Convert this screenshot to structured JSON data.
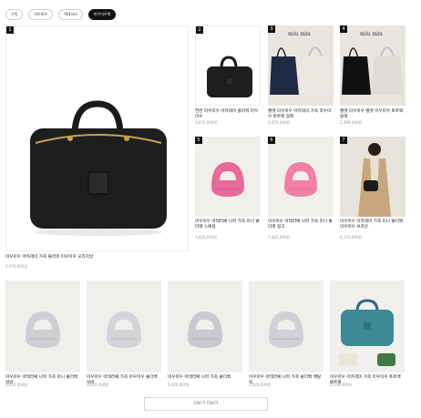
{
  "filters": [
    {
      "label": "구독",
      "active": false
    },
    {
      "label": "미우미우",
      "active": false
    },
    {
      "label": "액세서리",
      "active": false
    },
    {
      "label": "미우미우백",
      "active": true
    }
  ],
  "products": [
    {
      "rank": "1",
      "name": "미우미우 아카데미 가죽 플라워 미우미우 오리지날",
      "price": "4,970,000원",
      "brand_text": ""
    },
    {
      "rank": "2",
      "name": "한번 미우미우 아카데미 플라워 미우미우",
      "price": "4,970,000원",
      "brand_text": ""
    },
    {
      "rank": "3",
      "name": "벨벳 미우미우 아카데미 가죽 미우미우 토트백 블랙",
      "price": "2,970,000원",
      "brand_text": "miu miu"
    },
    {
      "rank": "4",
      "name": "벨벳 미우미우 벨벳 미우미우 토트백 블랙",
      "price": "2,390,000원",
      "brand_text": "miu miu"
    },
    {
      "rank": "5",
      "name": "미우미우 마테라쎄 나파 가죽 미니 숄더백 스페셜",
      "price": "3,420,000원",
      "brand_text": ""
    },
    {
      "rank": "6",
      "name": "미우미우 마테라쎄 나파 가죽 미니 숄더백 핑크",
      "price": "3,420,000원",
      "brand_text": ""
    },
    {
      "rank": "7",
      "name": "미우미우 아카데미 가죽 미니 숄더백 미우미우 브라운",
      "price": "6,150,000원",
      "brand_text": ""
    },
    {
      "rank": "",
      "name": "미우미우 마테라쎄 나파 가죽 미니 숄더백 실버",
      "price": "3,420,000원",
      "brand_text": ""
    },
    {
      "rank": "",
      "name": "미우미우 마테라쎄 가죽 미우미우 숄더백 실버",
      "price": "3,420,000원",
      "brand_text": ""
    },
    {
      "rank": "",
      "name": "미우미우 마테라쎄 나파 가죽 숄더백",
      "price": "3,420,000원",
      "brand_text": ""
    },
    {
      "rank": "",
      "name": "미우미우 마테라쎄 나파 가죽 숄더백 메탈릭",
      "price": "3,420,000원",
      "brand_text": ""
    },
    {
      "rank": "",
      "name": "미우미우 아카데미 가죽 미우미우 토트백 페트롤",
      "price": "3,550,000원",
      "brand_text": ""
    }
  ],
  "more_button": "더보기 더보기",
  "colors": {
    "accent": "#111111",
    "price": "#999999",
    "image_bg": "#f2f0ee"
  }
}
